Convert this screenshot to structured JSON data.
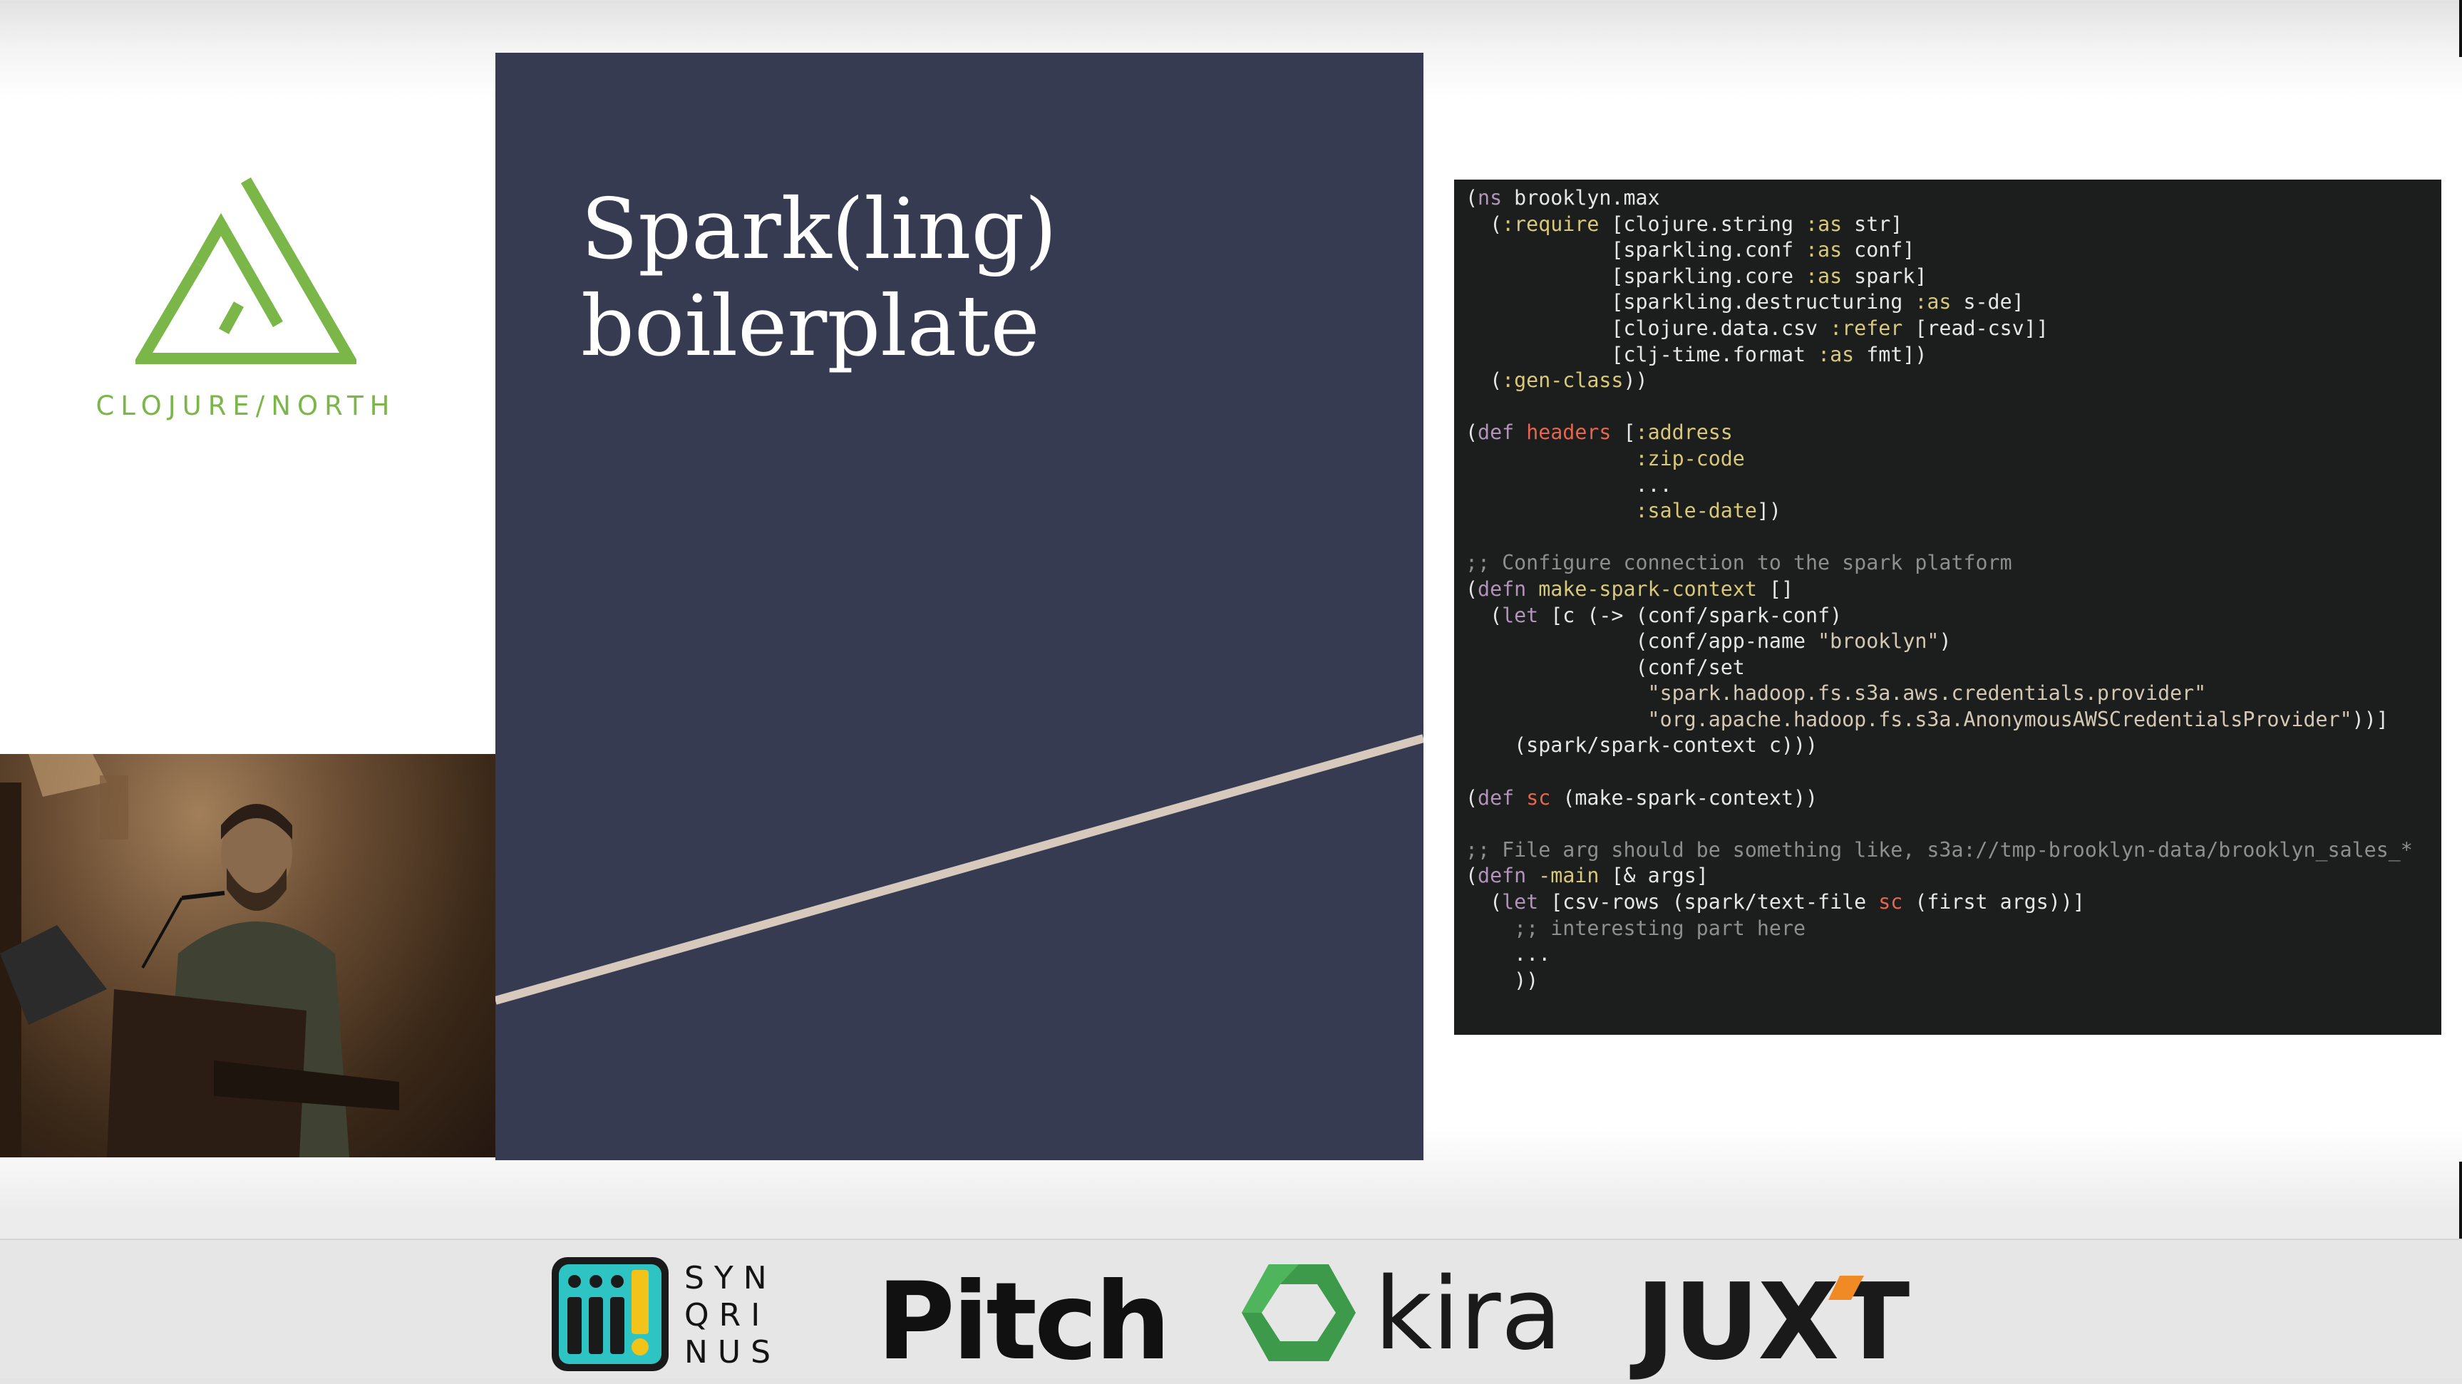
{
  "conference": {
    "wordmark": "CLOJURE/NORTH"
  },
  "slide": {
    "title_line1": "Spark(ling)",
    "title_line2": "boilerplate"
  },
  "colors": {
    "brand_green": "#7ab648",
    "slide_bg": "#363b51",
    "code_bg": "#1b1e1c",
    "accent_line": "#d8c9bd"
  },
  "code_lines": [
    "(ns brooklyn.max",
    "  (:require [clojure.string :as str]",
    "            [sparkling.conf :as conf]",
    "            [sparkling.core :as spark]",
    "            [sparkling.destructuring :as s-de]",
    "            [clojure.data.csv :refer [read-csv]]",
    "            [clj-time.format :as fmt])",
    "  (:gen-class))",
    "",
    "(def headers [:address",
    "              :zip-code",
    "              ...",
    "              :sale-date])",
    "",
    ";; Configure connection to the spark platform",
    "(defn make-spark-context []",
    "  (let [c (-> (conf/spark-conf)",
    "              (conf/app-name \"brooklyn\")",
    "              (conf/set",
    "               \"spark.hadoop.fs.s3a.aws.credentials.provider\"",
    "               \"org.apache.hadoop.fs.s3a.AnonymousAWSCredentialsProvider\"))]",
    "    (spark/spark-context c)))",
    "",
    "(def sc (make-spark-context))",
    "",
    ";; File arg should be something like, s3a://tmp-brooklyn-data/brooklyn_sales_*",
    "(defn -main [& args]",
    "  (let [csv-rows (spark/text-file sc (first args))]",
    "    ;; interesting part here",
    "    ...",
    "    ))"
  ],
  "sponsors": {
    "synqrinus": {
      "row1": "SYN",
      "row2": "QRI",
      "row3": "NUS",
      "icon": "synqrinus-logo-icon"
    },
    "pitch": "Pitch",
    "kira": {
      "word": "kira",
      "icon": "kira-hexagon-icon"
    },
    "juxt": "JUXT"
  }
}
